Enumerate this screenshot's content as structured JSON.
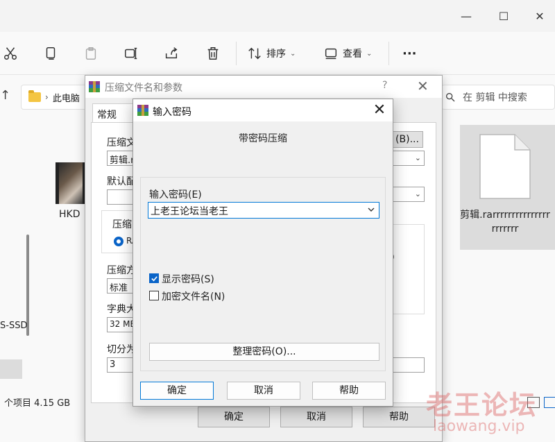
{
  "explorer": {
    "toolbar": {
      "sort_label": "排序",
      "view_label": "查看",
      "more_label": "···"
    },
    "breadcrumb_label": "此电脑",
    "search_placeholder": "在 剪辑 中搜索",
    "nav_drive_label": "S-SSD",
    "file_left_label": "HKD",
    "file_right_label": "剪辑.rarrrrrrrrrrrrrrrrrrrrrr",
    "status_text": "个项目  4.15 GB"
  },
  "parent_dialog": {
    "title": "压缩文件名和参数",
    "help_label": "?",
    "tab_general": "常规",
    "archive_name_label": "压缩文",
    "archive_name_value": "剪辑.r",
    "browse_label": "(B)...",
    "default_profile_label": "默认配",
    "format_group_label": "压缩",
    "format_option": "RA",
    "method_label": "压缩方",
    "method_value": "标准",
    "dict_label": "字典大",
    "dict_value": "32 MB",
    "split_label": "切分为",
    "split_value": "3",
    "ok_label": "确定",
    "cancel_label": "取消",
    "help_button_label": "帮助"
  },
  "password_dialog": {
    "title": "输入密码",
    "heading": "带密码压缩",
    "password_label": "输入密码(E)",
    "password_value": "上老王论坛当老王",
    "show_password_label": "显示密码(S)",
    "show_password_checked": true,
    "encrypt_filenames_label": "加密文件名(N)",
    "encrypt_filenames_checked": false,
    "organize_label": "整理密码(O)...",
    "ok_label": "确定",
    "cancel_label": "取消",
    "help_label": "帮助"
  },
  "watermark": {
    "title": "老王论坛",
    "url": "laowang.vip"
  },
  "colors": {
    "accent": "#0a64c8",
    "focus_border": "#0078d7",
    "watermark": "#dc6464"
  }
}
